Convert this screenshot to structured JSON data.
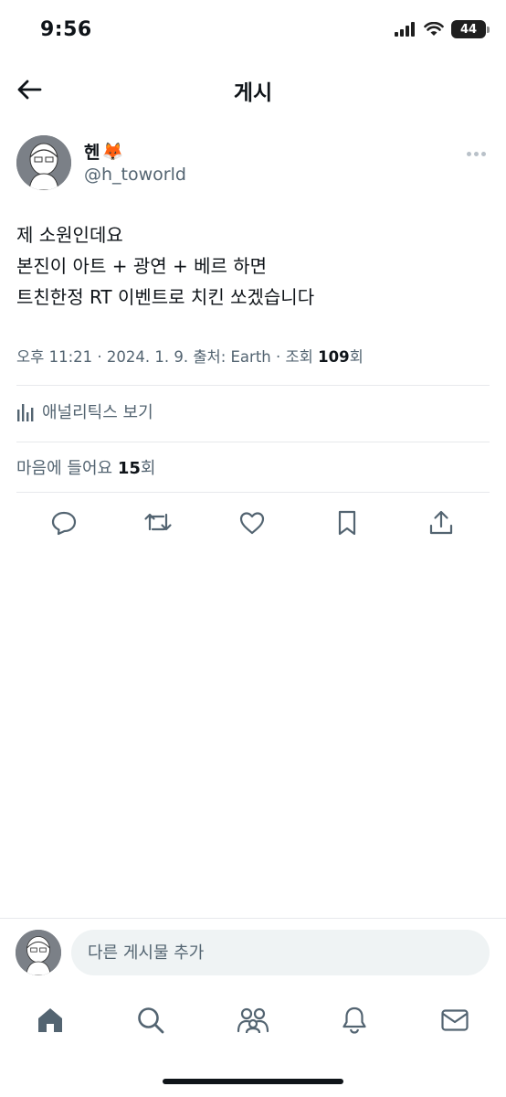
{
  "status_bar": {
    "time": "9:56",
    "battery": "44"
  },
  "header": {
    "title": "게시"
  },
  "author": {
    "name": "헨",
    "emoji": "🦊",
    "handle": "@h_toworld"
  },
  "post": {
    "lines": [
      "제 소원인데요",
      "본진이 아트 + 광연 + 베르 하면",
      "트친한정 RT 이벤트로 치킨 쏘겠습니다"
    ]
  },
  "meta": {
    "prefix": "오후 11:21 · 2024. 1. 9. 출처: Earth · 조회 ",
    "views": "109",
    "suffix": "회"
  },
  "analytics": {
    "label": "애널리틱스 보기"
  },
  "likes": {
    "prefix": "마음에 들어요 ",
    "count": "15",
    "suffix": "회"
  },
  "reply": {
    "placeholder": "다른 게시물 추가"
  },
  "icons": {
    "back": "back-arrow-icon",
    "more": "more-dots-icon",
    "reply": "reply-icon",
    "retweet": "retweet-icon",
    "like": "heart-icon",
    "bookmark": "bookmark-icon",
    "share": "share-icon",
    "home": "home-icon",
    "search": "search-icon",
    "communities": "communities-icon",
    "notifications": "bell-icon",
    "messages": "mail-icon"
  },
  "colors": {
    "text": "#0f1419",
    "secondary": "#536471",
    "divider": "#e7e9ec",
    "input_bg": "#eff3f4"
  }
}
